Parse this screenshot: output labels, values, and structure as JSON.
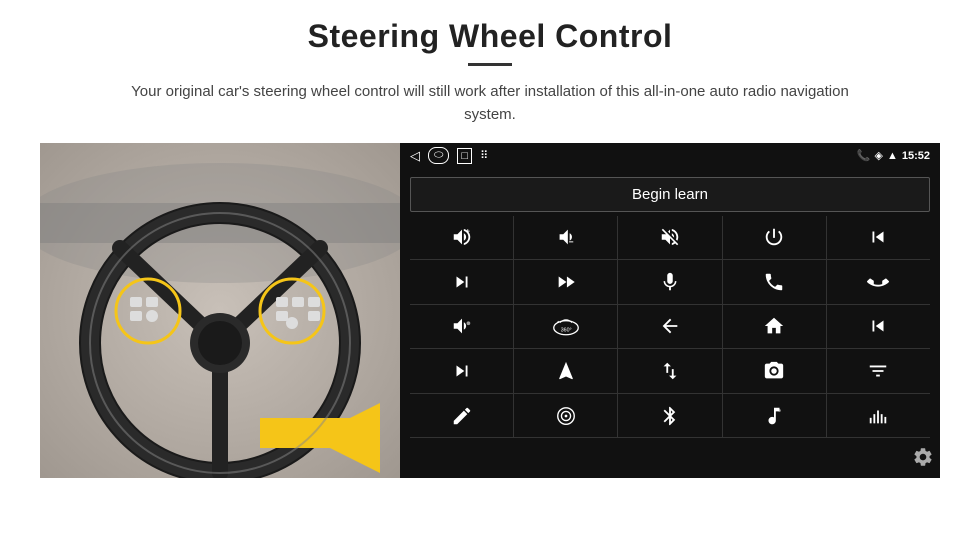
{
  "header": {
    "title": "Steering Wheel Control",
    "divider": true,
    "subtitle": "Your original car's steering wheel control will still work after installation of this all-in-one auto radio navigation system."
  },
  "status_bar": {
    "left_icons": [
      "back-arrow",
      "home-oval",
      "square-recent",
      "grid-dots"
    ],
    "right_phone": "📞",
    "right_location": "📍",
    "right_wifi": "📶",
    "right_time": "15:52"
  },
  "begin_learn_button": {
    "label": "Begin learn"
  },
  "icon_grid": {
    "cells": [
      {
        "icon": "🔊+",
        "name": "vol-up"
      },
      {
        "icon": "🔊−",
        "name": "vol-down"
      },
      {
        "icon": "🔇",
        "name": "mute"
      },
      {
        "icon": "⏻",
        "name": "power"
      },
      {
        "icon": "⏮",
        "name": "prev-track-phone"
      },
      {
        "icon": "⏭",
        "name": "next-track"
      },
      {
        "icon": "⏩",
        "name": "fast-forward"
      },
      {
        "icon": "🎤",
        "name": "microphone"
      },
      {
        "icon": "📞",
        "name": "call"
      },
      {
        "icon": "📵",
        "name": "hang-up"
      },
      {
        "icon": "📢",
        "name": "horn"
      },
      {
        "icon": "🔄",
        "name": "360-view"
      },
      {
        "icon": "↩",
        "name": "back"
      },
      {
        "icon": "🏠",
        "name": "home"
      },
      {
        "icon": "⏮⏮",
        "name": "prev-track2"
      },
      {
        "icon": "⏭",
        "name": "skip-forward"
      },
      {
        "icon": "➤",
        "name": "navigation"
      },
      {
        "icon": "⇄",
        "name": "switch"
      },
      {
        "icon": "📷",
        "name": "camera"
      },
      {
        "icon": "🎚",
        "name": "equalizer"
      },
      {
        "icon": "✏",
        "name": "edit"
      },
      {
        "icon": "⊙",
        "name": "target"
      },
      {
        "icon": "✱",
        "name": "bluetooth"
      },
      {
        "icon": "🎵",
        "name": "music"
      },
      {
        "icon": "📊",
        "name": "spectrum"
      }
    ]
  },
  "settings": {
    "icon_label": "⚙",
    "name": "settings"
  }
}
